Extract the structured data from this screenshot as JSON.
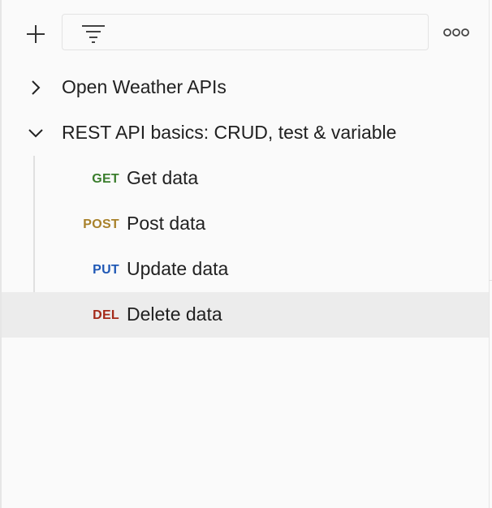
{
  "toolbar": {
    "filter_placeholder": "",
    "filter_value": ""
  },
  "collections": [
    {
      "label": "Open Weather APIs",
      "expanded": false
    },
    {
      "label": "REST API basics: CRUD, test & variable",
      "expanded": true,
      "requests": [
        {
          "method": "GET",
          "method_color": "#3a7d2c",
          "label": "Get data"
        },
        {
          "method": "POST",
          "method_color": "#a8812a",
          "label": "Post data"
        },
        {
          "method": "PUT",
          "method_color": "#1f58b5",
          "label": "Update data"
        },
        {
          "method": "DEL",
          "method_color": "#a42a1a",
          "label": "Delete data",
          "selected": true
        }
      ]
    }
  ],
  "icons": {
    "add": "plus-icon",
    "filter": "filter-icon",
    "more": "more-horizontal-icon",
    "collapsed": "chevron-right-icon",
    "expanded": "chevron-down-icon"
  }
}
